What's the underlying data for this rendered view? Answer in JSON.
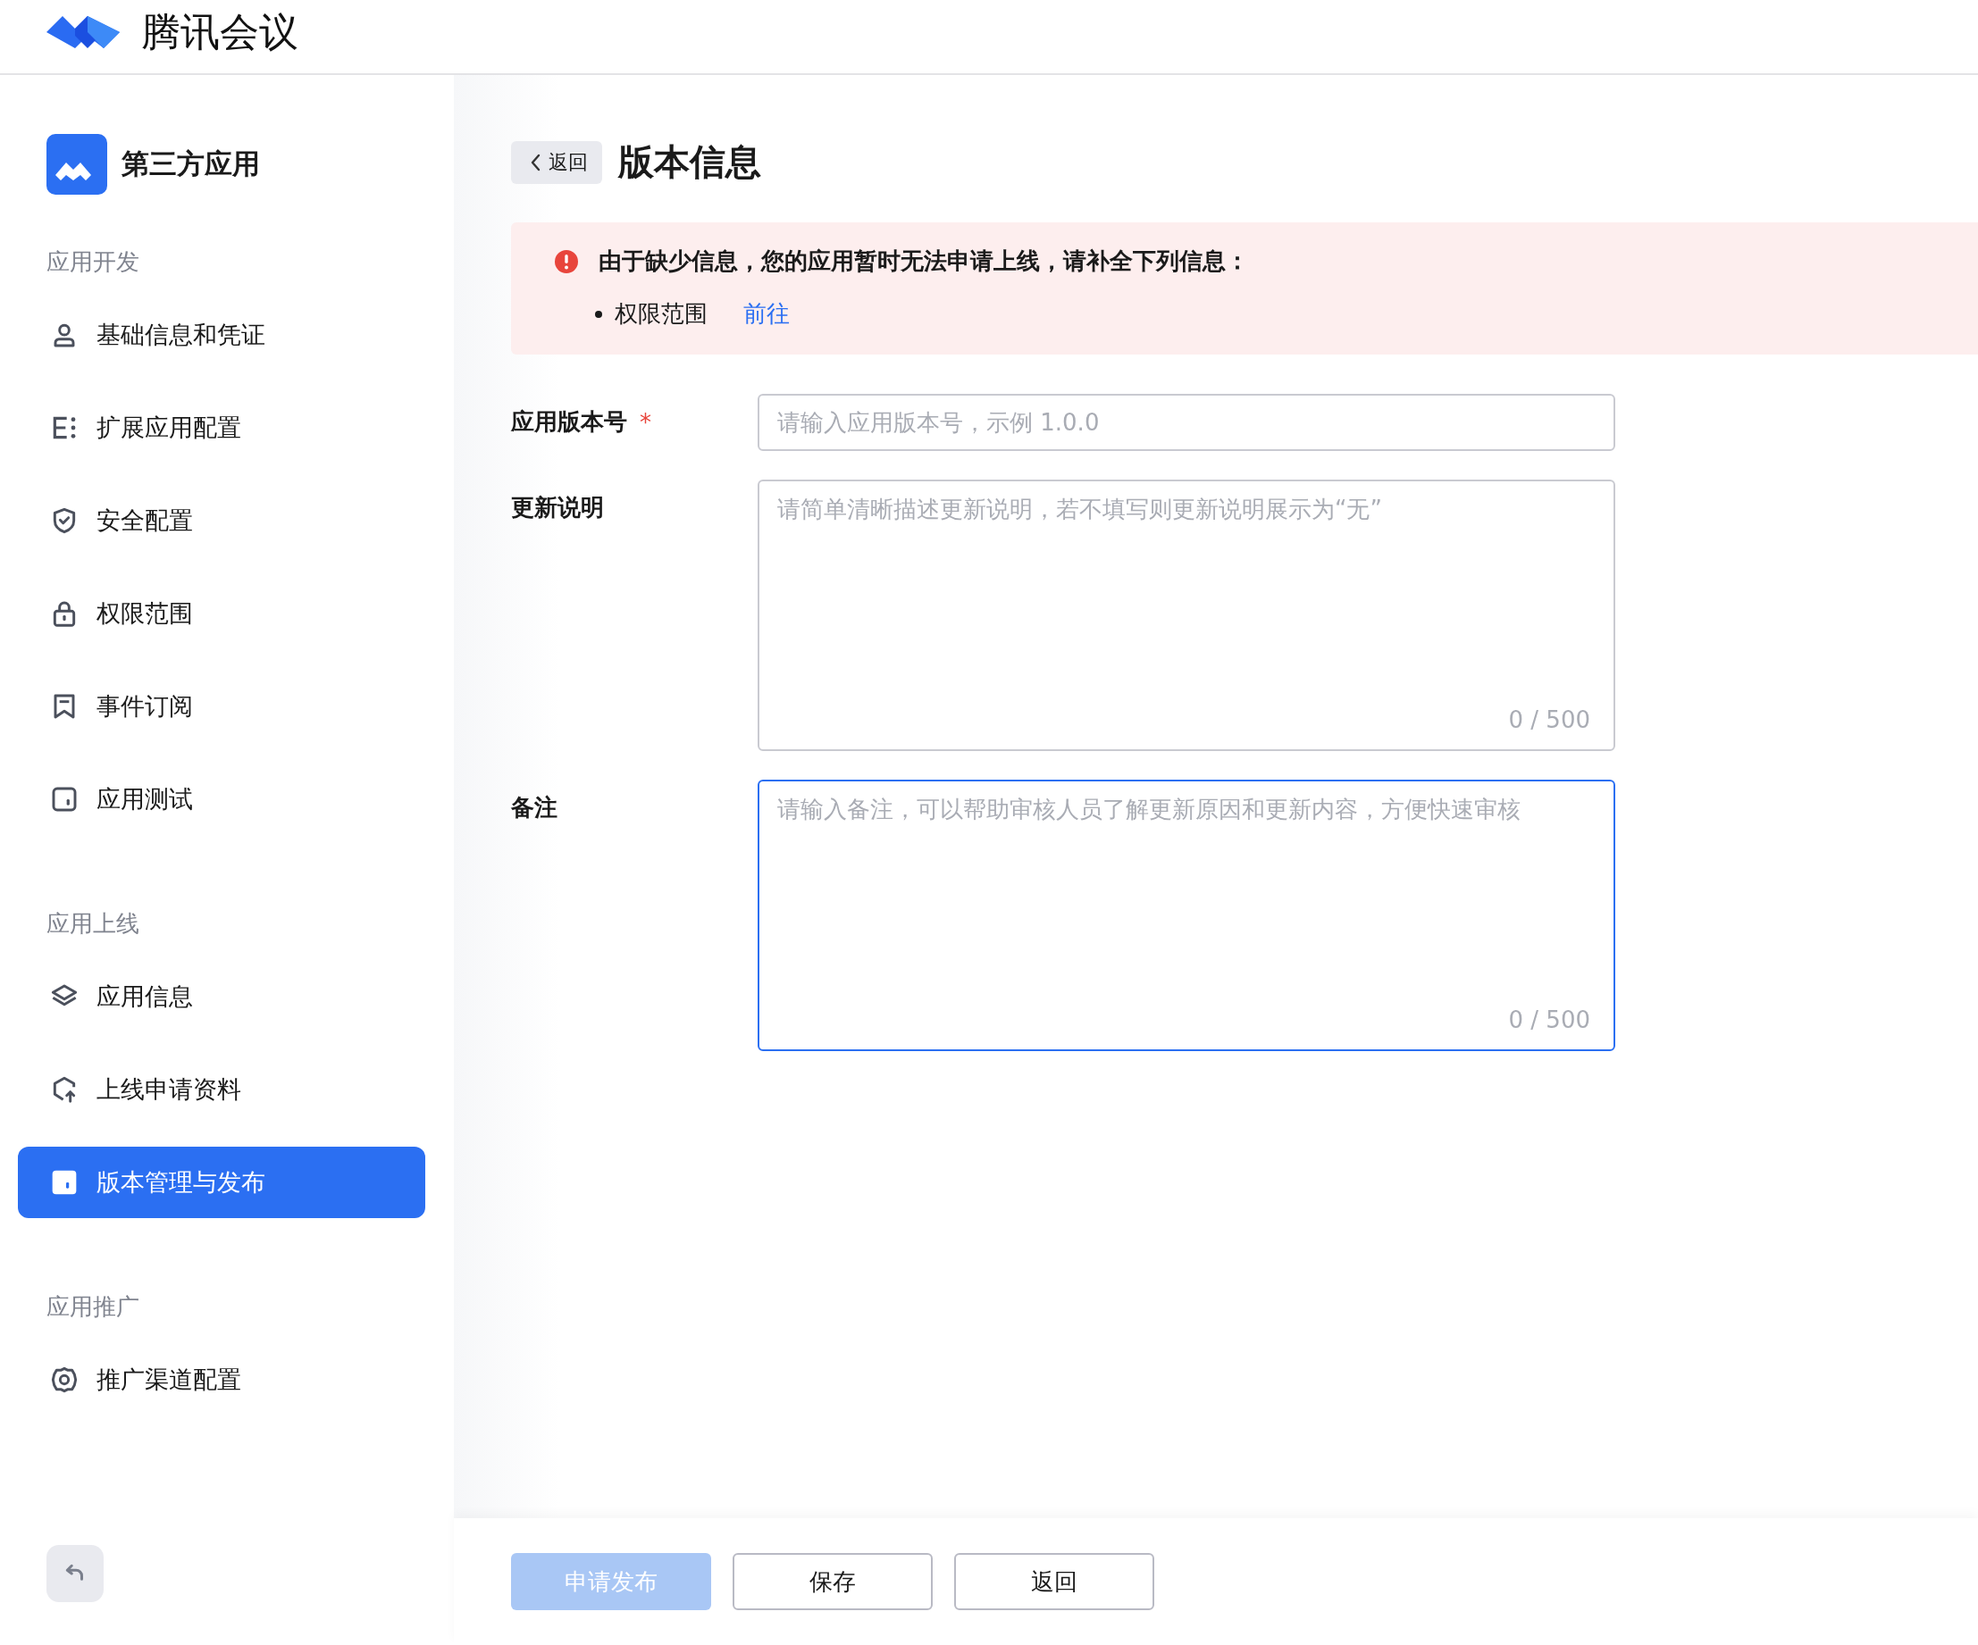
{
  "header": {
    "brand": "腾讯会议"
  },
  "sidebar": {
    "app_name": "第三方应用",
    "sections": [
      {
        "title": "应用开发",
        "items": [
          {
            "kind": "user",
            "label": "基础信息和凭证",
            "selected": false
          },
          {
            "kind": "extend",
            "label": "扩展应用配置",
            "selected": false
          },
          {
            "kind": "shield",
            "label": "安全配置",
            "selected": false
          },
          {
            "kind": "lock",
            "label": "权限范围",
            "selected": false
          },
          {
            "kind": "bookmark",
            "label": "事件订阅",
            "selected": false
          },
          {
            "kind": "square",
            "label": "应用测试",
            "selected": false
          }
        ]
      },
      {
        "title": "应用上线",
        "items": [
          {
            "kind": "layers",
            "label": "应用信息",
            "selected": false
          },
          {
            "kind": "upload",
            "label": "上线申请资料",
            "selected": false
          },
          {
            "kind": "square",
            "label": "版本管理与发布",
            "selected": true
          }
        ]
      },
      {
        "title": "应用推广",
        "items": [
          {
            "kind": "gear",
            "label": "推广渠道配置",
            "selected": false
          }
        ]
      }
    ]
  },
  "page": {
    "back": "返回",
    "title": "版本信息"
  },
  "alert": {
    "message": "由于缺少信息，您的应用暂时无法申请上线，请补全下列信息：",
    "items": [
      {
        "label": "权限范围",
        "link": "前往"
      }
    ]
  },
  "form": {
    "fields": [
      {
        "kind": "input",
        "label": "应用版本号",
        "required_mark": "*",
        "placeholder": "请输入应用版本号，示例 1.0.0",
        "focused": false
      },
      {
        "kind": "textarea",
        "label": "更新说明",
        "placeholder": "请简单清晰描述更新说明，若不填写则更新说明展示为“无”",
        "counter": "0 / 500",
        "focused": false
      },
      {
        "kind": "textarea",
        "label": "备注",
        "placeholder": "请输入备注，可以帮助审核人员了解更新原因和更新内容，方便快速审核",
        "counter": "0 / 500",
        "focused": true
      }
    ]
  },
  "footer": {
    "buttons": [
      {
        "label": "申请发布",
        "kind": "primary",
        "disabled": true
      },
      {
        "label": "保存",
        "kind": "default",
        "disabled": false
      },
      {
        "label": "返回",
        "kind": "default",
        "disabled": false
      }
    ]
  }
}
